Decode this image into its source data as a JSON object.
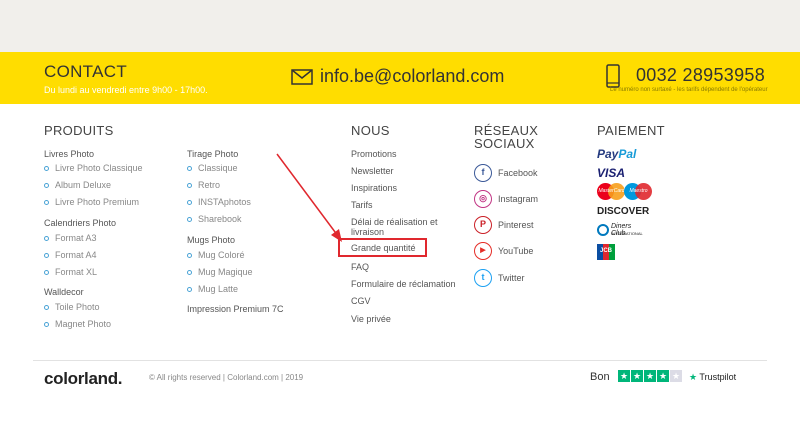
{
  "contact": {
    "title": "CONTACT",
    "hours": "Du lundi au vendredi entre 9h00 - 17h00.",
    "email": "info.be@colorland.com",
    "phone": "0032 28953958",
    "phone_note": "Le numéro non surtaxé - les tarifs dépendent de l'opérateur"
  },
  "produits": {
    "title": "PRODUITS",
    "groups": [
      {
        "label": "Livres Photo",
        "items": [
          "Livre Photo Classique",
          "Album Deluxe",
          "Livre Photo Premium"
        ]
      },
      {
        "label": "Calendriers Photo",
        "items": [
          "Format A3",
          "Format A4",
          "Format XL"
        ]
      },
      {
        "label": "Walldecor",
        "items": [
          "Toile Photo",
          "Magnet Photo"
        ]
      }
    ],
    "groups2": [
      {
        "label": "Tirage Photo",
        "items": [
          "Classique",
          "Retro",
          "INSTAphotos",
          "Sharebook"
        ]
      },
      {
        "label": "Mugs Photo",
        "items": [
          "Mug Coloré",
          "Mug Magique",
          "Mug Latte"
        ]
      },
      {
        "label": "Impression Premium 7C",
        "items": []
      }
    ]
  },
  "nous": {
    "title": "NOUS",
    "items": [
      "Promotions",
      "Newsletter",
      "Inspirations",
      "Tarifs",
      "Délai de réalisation et",
      "livraison",
      "Grande quantité",
      "FAQ",
      "Formulaire de réclamation",
      "CGV",
      "Vie privée"
    ]
  },
  "reseaux": {
    "title_line1": "RÉSEAUX",
    "title_line2": "SOCIAUX",
    "items": [
      {
        "label": "Facebook",
        "icon": "facebook-icon",
        "glyph": "f",
        "color": "#3b5998"
      },
      {
        "label": "Instagram",
        "icon": "instagram-icon",
        "glyph": "◎",
        "color": "#c13584"
      },
      {
        "label": "Pinterest",
        "icon": "pinterest-icon",
        "glyph": "P",
        "color": "#cb2027"
      },
      {
        "label": "YouTube",
        "icon": "youtube-icon",
        "glyph": "▶",
        "color": "#e52d27"
      },
      {
        "label": "Twitter",
        "icon": "twitter-icon",
        "glyph": "t",
        "color": "#1da1f2"
      }
    ]
  },
  "paiement": {
    "title": "PAIEMENT",
    "paypal_a": "Pay",
    "paypal_b": "Pal",
    "visa": "VISA",
    "mastercard": "MasterCard",
    "maestro": "Maestro",
    "discover": "DISCOVER",
    "diners_a": "Diners Club",
    "diners_b": "INTERNATIONAL",
    "jcb": "JCB"
  },
  "footer": {
    "logo": "colorland.",
    "copyright": "© All rights reserved | Colorland.com | 2019",
    "rating_word": "Bon",
    "trustpilot": "Trustpilot",
    "stars_filled": 4,
    "stars_total": 5
  },
  "colors": {
    "yellow": "#ffdd00",
    "accent": "#4aa3d6",
    "highlight": "#e0282e",
    "trustpilot": "#00b67a"
  }
}
